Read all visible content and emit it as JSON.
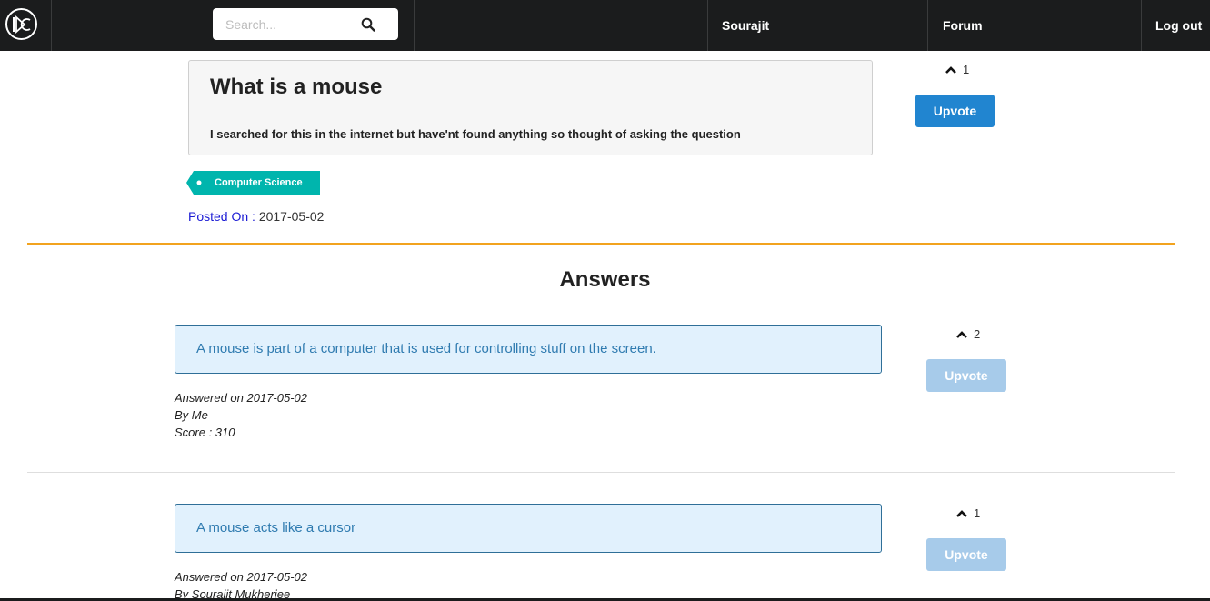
{
  "navbar": {
    "search_placeholder": "Search...",
    "user_name": "Sourajit",
    "forum_label": "Forum",
    "logout_label": "Log out"
  },
  "question": {
    "title": "What is a mouse",
    "body": "I searched for this in the internet but have'nt found anything so thought of asking the question",
    "votes": "1",
    "upvote_label": "Upvote",
    "tag": "Computer Science",
    "posted_label": "Posted On :",
    "posted_date": "2017-05-02"
  },
  "answers_heading": "Answers",
  "answers": [
    {
      "text": "A mouse is part of a computer that is used for controlling stuff on the screen.",
      "answered_label": "Answered on",
      "date": "2017-05-02",
      "by": "By Me",
      "score": "Score : 310",
      "votes": "2",
      "upvote_label": "Upvote"
    },
    {
      "text": "A mouse acts like a cursor",
      "answered_label": "Answered on",
      "date": "2017-05-02",
      "by": "By Sourajit Mukherjee",
      "votes": "1",
      "upvote_label": "Upvote"
    }
  ],
  "colors": {
    "navbar": "#1b1c1d",
    "upvote_active": "#2185d0",
    "upvote_disabled": "#a7cbea",
    "tag": "#00b5ad",
    "divider": "#f2a31f",
    "answer_bg": "#e1f1fd"
  }
}
